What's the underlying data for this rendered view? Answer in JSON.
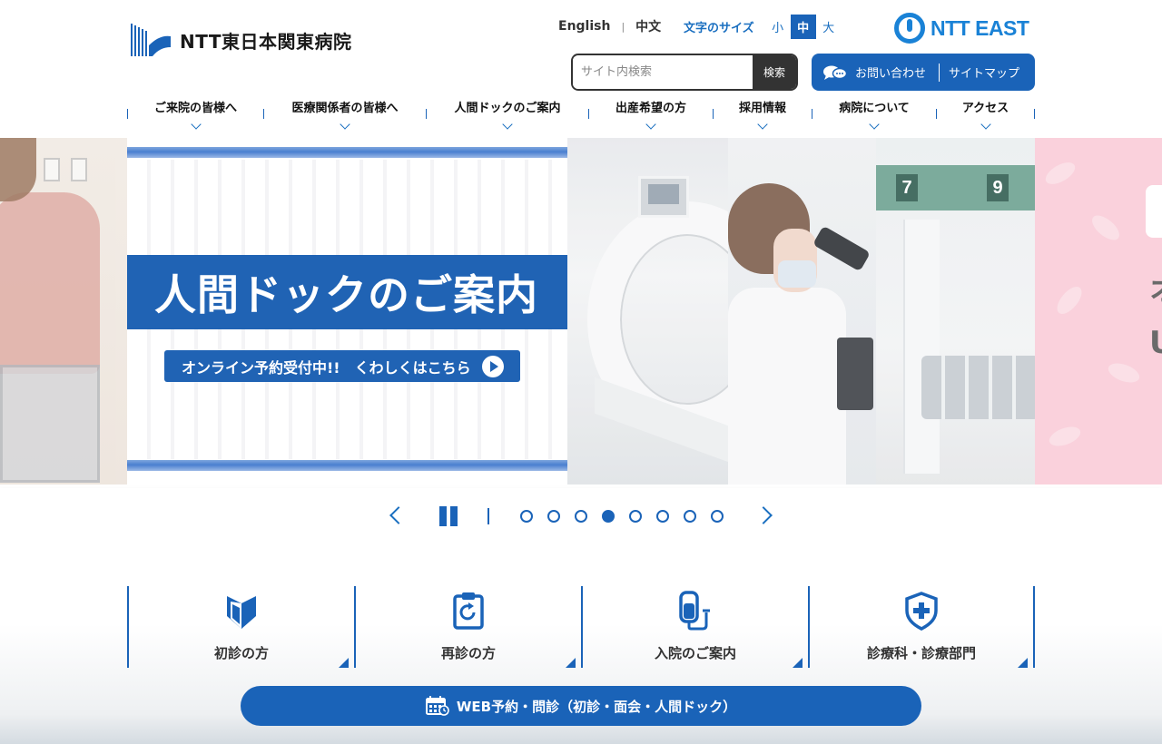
{
  "header": {
    "logo_text": "NTT東日本関東病院",
    "languages": [
      "English",
      "中文"
    ],
    "language_separator": "|",
    "font_size": {
      "label": "文字のサイズ",
      "options": [
        "小",
        "中",
        "大"
      ],
      "selected": "中"
    },
    "partner_logo": "NTT EAST",
    "search": {
      "placeholder": "サイト内検索",
      "value": "",
      "button": "検索"
    },
    "contact_label": "お問い合わせ",
    "sitemap_label": "サイトマップ"
  },
  "nav": {
    "items": [
      {
        "label": "ご来院の皆様へ"
      },
      {
        "label": "医療関係者の皆様へ"
      },
      {
        "label": "人間ドックのご案内"
      },
      {
        "label": "出産希望の方"
      },
      {
        "label": "採用情報"
      },
      {
        "label": "病院について"
      },
      {
        "label": "アクセス"
      }
    ]
  },
  "hero": {
    "title": "人間ドックのご案内",
    "button_label": "オンライン予約受付中!!　くわしくはこちら",
    "lobby_signs": [
      "7",
      "9"
    ],
    "next_slide_partial": [
      "オ",
      "U"
    ]
  },
  "slider": {
    "dot_count": 8,
    "active_index": 3,
    "separator": "|"
  },
  "quick_links": [
    {
      "label": "初診の方",
      "icon": "beginner-mark-icon"
    },
    {
      "label": "再診の方",
      "icon": "clipboard-refresh-icon"
    },
    {
      "label": "入院のご案内",
      "icon": "iv-drip-icon"
    },
    {
      "label": "診療科・診療部門",
      "icon": "medical-shield-icon"
    }
  ],
  "web_reservation": {
    "label": "WEB予約・問診（初診・面会・人間ドック）",
    "icon": "calendar-icon"
  },
  "colors": {
    "primary": "#1a63b8",
    "accent": "#1a82d6",
    "dark": "#333333"
  }
}
